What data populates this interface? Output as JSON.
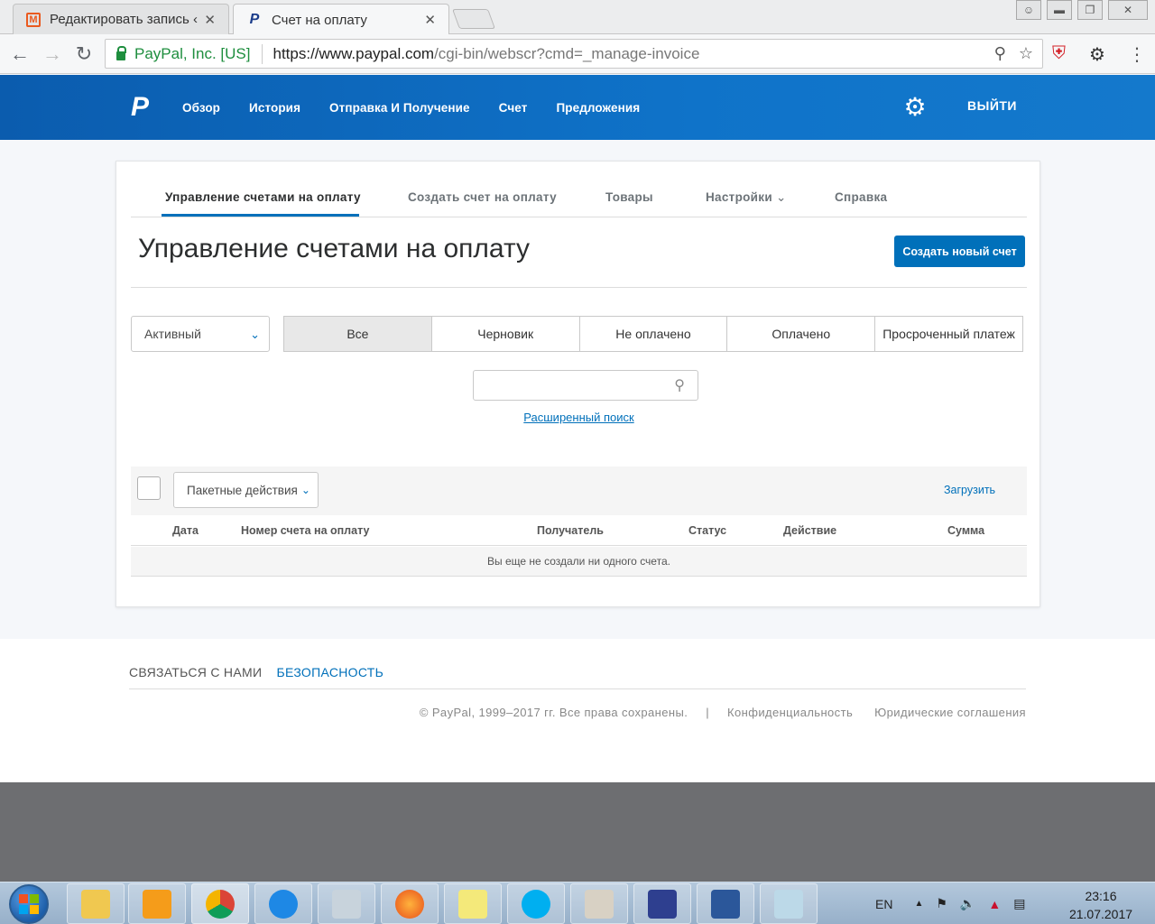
{
  "browser": {
    "tabs": [
      {
        "title": "Редактировать запись ‹",
        "active": false,
        "favicon": "m-icon"
      },
      {
        "title": "Счет на оплату",
        "active": true,
        "favicon": "paypal-icon"
      }
    ],
    "address": {
      "ev_label": "PayPal, Inc. [US]",
      "url_host": "https://www.paypal.com",
      "url_path": "/cgi-bin/webscr?cmd=_manage-invoice"
    }
  },
  "header": {
    "nav": [
      "Обзор",
      "История",
      "Отправка И Получение",
      "Счет",
      "Предложения"
    ],
    "logout": "ВЫЙТИ"
  },
  "subnav": {
    "items": [
      "Управление счетами на оплату",
      "Создать счет на оплату",
      "Товары",
      "Настройки",
      "Справка"
    ],
    "active_index": 0
  },
  "main": {
    "title": "Управление счетами на оплату",
    "create_button": "Создать новый счет",
    "status_select": "Активный",
    "filters": [
      "Все",
      "Черновик",
      "Не оплачено",
      "Оплачено",
      "Просроченный платеж"
    ],
    "filter_selected": "Все",
    "search": {
      "value": "",
      "placeholder": ""
    },
    "advanced_search": "Расширенный поиск",
    "batch_actions": "Пакетные действия",
    "upload": "Загрузить",
    "columns": [
      "Дата",
      "Номер счета на оплату",
      "Получатель",
      "Статус",
      "Действие",
      "Сумма"
    ],
    "empty_message": "Вы еще не создали ни одного счета."
  },
  "footer": {
    "contact": "СВЯЗАТЬСЯ С НАМИ",
    "security": "БЕЗОПАСНОСТЬ",
    "copyright": "© PayPal, 1999–2017 гг. Все права сохранены.",
    "divider": "|",
    "privacy": "Конфиденциальность",
    "legal": "Юридические соглашения"
  },
  "taskbar": {
    "lang": "EN",
    "time": "23:16",
    "date": "21.07.2017"
  },
  "colors": {
    "brand_blue": "#0070ba",
    "header_blue": "#0b5cae",
    "chrome_green": "#1e8e3e"
  }
}
